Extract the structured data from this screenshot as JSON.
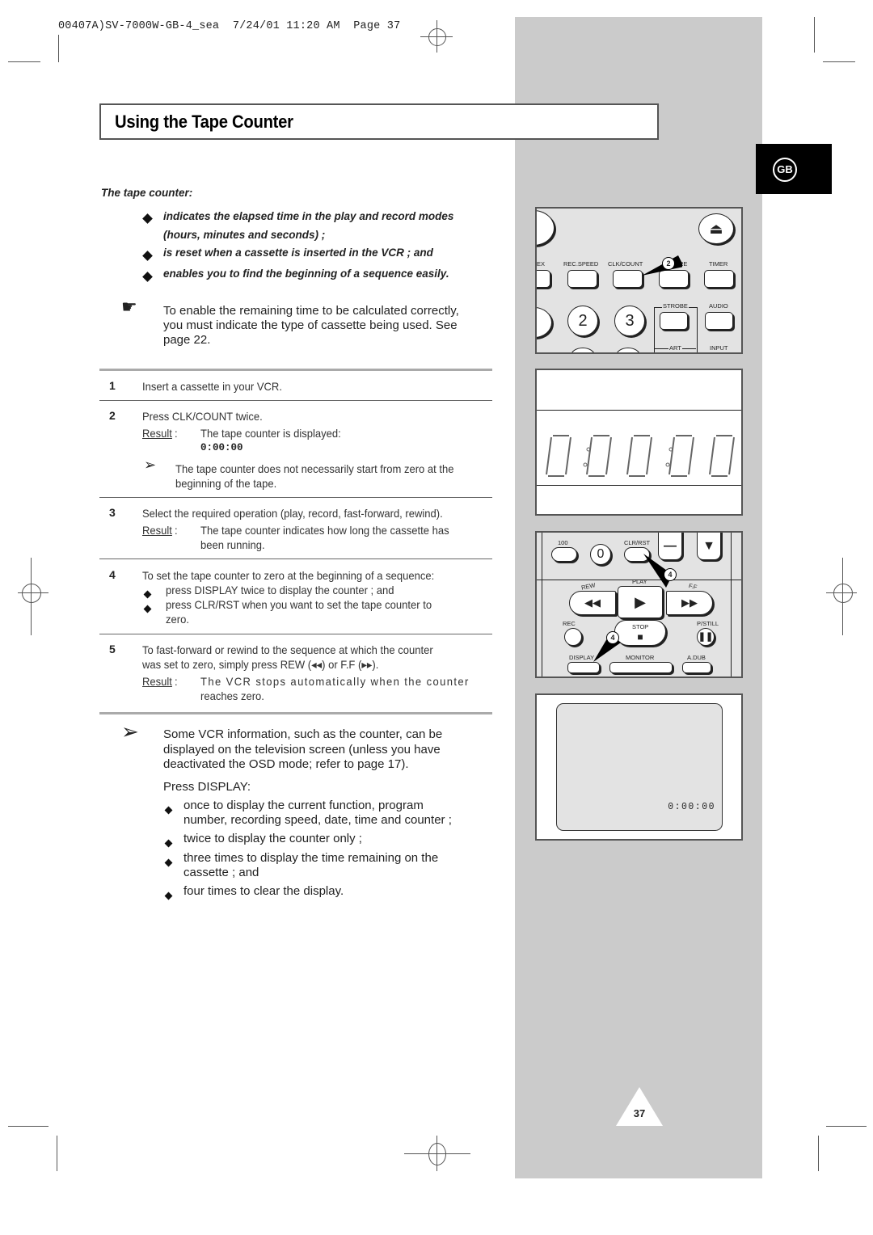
{
  "print_header": "00407A)SV-7000W-GB-4_sea  7/24/01 11:20 AM  Page 37",
  "title": "Using the Tape Counter",
  "language_badge": "GB",
  "intro": {
    "heading": "The tape counter:",
    "bullets": [
      "indicates the elapsed time in the play and record modes",
      "(hours, minutes and seconds) ;",
      "is reset when a cassette is inserted in the VCR ; and",
      "enables you to find the beginning of a sequence easily."
    ]
  },
  "note": {
    "icon": "pointing-hand-icon",
    "lines": [
      "To enable the remaining time to be calculated correctly,",
      "you must indicate the type of cassette being used. See",
      "page 22."
    ]
  },
  "steps": [
    {
      "num": "1",
      "text": "Insert a cassette in your VCR."
    },
    {
      "num": "2",
      "text": "Press CLK/COUNT twice.",
      "result_label": "Result",
      "result": "The tape counter is displayed:",
      "result_value": "0:00:00",
      "tip_lines": [
        "The tape counter does not necessarily start from zero at the",
        "beginning of the tape."
      ]
    },
    {
      "num": "3",
      "text": "Select the required operation (play, record, fast-forward, rewind).",
      "result_label": "Result",
      "result_lines": [
        "The tape counter indicates how long the cassette has",
        "been running."
      ]
    },
    {
      "num": "4",
      "text": "To set the tape counter to zero at the beginning of a sequence:",
      "bullets": [
        "press DISPLAY twice to display the counter ; and",
        "press CLR/RST when you want to set the tape counter to",
        "zero."
      ]
    },
    {
      "num": "5",
      "text_lines": [
        "To fast-forward or rewind to the sequence at which the counter",
        "was set to zero, simply press REW (◂◂) or F.F (▸▸)."
      ],
      "result_label": "Result",
      "result_lines": [
        "The VCR stops automatically when the counter",
        "reaches zero."
      ]
    }
  ],
  "tip": {
    "lines": [
      "Some VCR information, such as the counter, can be",
      "displayed on the television screen (unless you have",
      "deactivated the OSD mode; refer to page 17)."
    ],
    "press_label": "Press DISPLAY:",
    "bullets": [
      [
        "once to display the current function, program",
        "number, recording speed, date, time and counter ;"
      ],
      [
        "twice to display the counter only ;"
      ],
      [
        "three times to display the time remaining on the",
        "cassette ; and"
      ],
      [
        "four times to clear the display."
      ]
    ]
  },
  "remote_top": {
    "labels": [
      "EX",
      "REC.SPEED",
      "CLK/COUNT",
      "RE",
      "TIMER",
      "STROBE",
      "AUDIO",
      "ART",
      "INPUT"
    ],
    "digits": [
      "2",
      "3"
    ],
    "callout": "2"
  },
  "vcr_display": {
    "value": "0:00:00"
  },
  "remote_bottom": {
    "labels": [
      "100",
      "CLR/RST",
      "PLAY",
      "REW",
      "F.F",
      "REC",
      "STOP",
      "P/STILL",
      "DISPLAY",
      "MONITOR",
      "A.DUB"
    ],
    "digit": "0",
    "callouts": [
      "4",
      "4"
    ]
  },
  "tv_screen": {
    "osd": "0:00:00"
  },
  "page_number": "37"
}
